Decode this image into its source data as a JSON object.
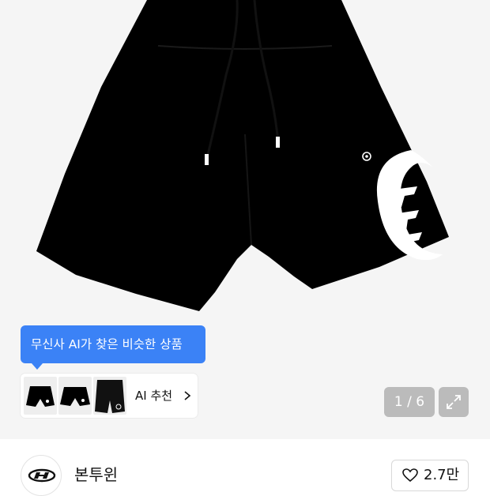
{
  "product_image": {
    "subject": "black shorts with white logo",
    "background_color": "#f5f5f5",
    "garment_color": "#000000",
    "logo_color": "#ffffff"
  },
  "ai_recommendation": {
    "tooltip_text": "무신사 AI가 찾은 비슷한 상품",
    "tooltip_color": "#3b82f6",
    "button_label": "AI 추천",
    "chevron_icon": "chevron-right-icon",
    "thumbnails": [
      {
        "description": "black shorts thumbnail"
      },
      {
        "description": "black shorts thumbnail"
      },
      {
        "description": "black shorts thumbnail"
      }
    ]
  },
  "gallery": {
    "page_counter": "1 / 6",
    "expand_icon": "expand-icon"
  },
  "brand": {
    "name": "본투윈",
    "logo_icon": "brand-logo-icon"
  },
  "like": {
    "icon": "heart-icon",
    "count": "2.7만"
  }
}
